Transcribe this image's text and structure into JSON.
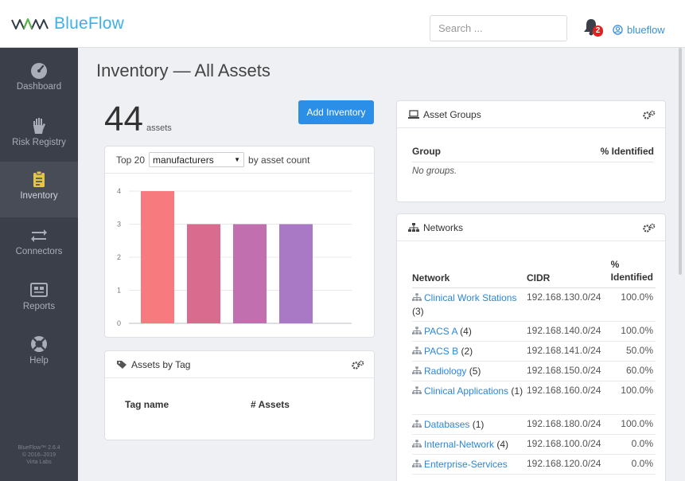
{
  "app": {
    "name": "BlueFlow"
  },
  "header": {
    "search_placeholder": "Search ...",
    "notification_count": "2",
    "username": "blueflow"
  },
  "sidebar": {
    "items": [
      {
        "label": "Dashboard",
        "icon": "speedometer-icon"
      },
      {
        "label": "Risk Registry",
        "icon": "hand-icon"
      },
      {
        "label": "Inventory",
        "icon": "clipboard-icon",
        "active": true
      },
      {
        "label": "Connectors",
        "icon": "arrows-exchange-icon"
      },
      {
        "label": "Reports",
        "icon": "report-icon"
      },
      {
        "label": "Help",
        "icon": "lifebuoy-icon"
      }
    ],
    "version": [
      "BlueFlow™ 2.6.4",
      "© 2016–2019",
      "Virta Labs"
    ]
  },
  "main": {
    "title": "Inventory — All Assets",
    "asset_count": "44",
    "asset_count_label": "assets",
    "add_button": "Add Inventory"
  },
  "chart_card": {
    "prefix": "Top 20",
    "select_value": "manufacturers",
    "suffix": "by asset count"
  },
  "chart_data": {
    "type": "bar",
    "categories": [
      "",
      "",
      "",
      ""
    ],
    "values": [
      4,
      3,
      3,
      3
    ],
    "ylim": [
      0,
      4
    ],
    "yticks": [
      "0",
      "1",
      "2",
      "3",
      "4"
    ],
    "colors": [
      "#f77a7f",
      "#d96b8f",
      "#c26fb0",
      "#a979c6"
    ],
    "grid": true
  },
  "tags_card": {
    "title": "Assets by Tag",
    "columns": [
      "Tag name",
      "# Assets"
    ]
  },
  "groups_card": {
    "title": "Asset Groups",
    "columns": [
      "Group",
      "% Identified"
    ],
    "empty_text": "No groups."
  },
  "networks_card": {
    "title": "Networks",
    "columns": {
      "network": "Network",
      "cidr": "CIDR",
      "pct_line1": "%",
      "pct_line2": "Identified"
    },
    "rows": [
      {
        "name": "Clinical Work Stations",
        "count": "(3)",
        "cidr": "192.168.130.0/24",
        "pct": "100.0%"
      },
      {
        "name": "PACS A",
        "count": "(4)",
        "cidr": "192.168.140.0/24",
        "pct": "100.0%"
      },
      {
        "name": "PACS B",
        "count": "(2)",
        "cidr": "192.168.141.0/24",
        "pct": "50.0%"
      },
      {
        "name": "Radiology",
        "count": "(5)",
        "cidr": "192.168.150.0/24",
        "pct": "60.0%"
      },
      {
        "name": "Clinical Applications",
        "count": "(1)",
        "cidr": "192.168.160.0/24",
        "pct": "100.0%"
      },
      {
        "name": "Databases",
        "count": "(1)",
        "cidr": "192.168.180.0/24",
        "pct": "100.0%"
      },
      {
        "name": "Internal-Network",
        "count": "(4)",
        "cidr": "192.168.100.0/24",
        "pct": "0.0%"
      },
      {
        "name": "Enterprise-Services",
        "count": "",
        "cidr": "192.168.120.0/24",
        "pct": "0.0%"
      }
    ]
  }
}
